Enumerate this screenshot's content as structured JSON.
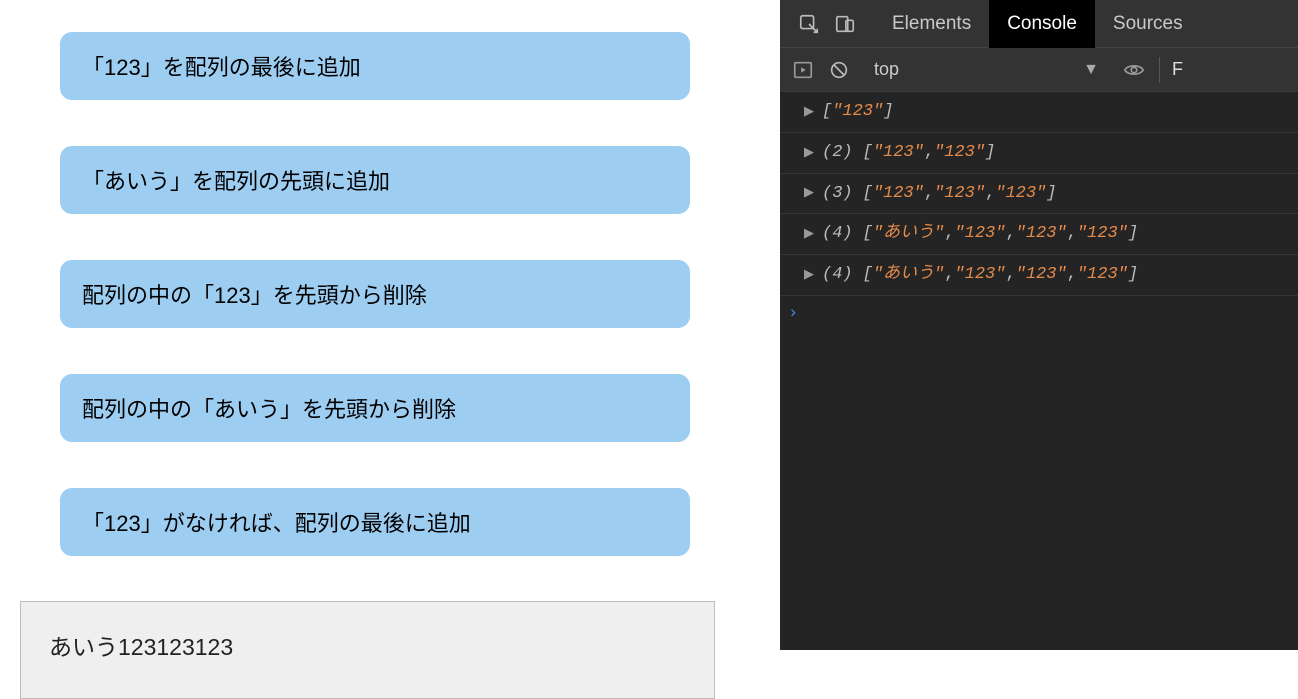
{
  "buttons": [
    "「123」を配列の最後に追加",
    "「あいう」を配列の先頭に追加",
    "配列の中の「123」を先頭から削除",
    "配列の中の「あいう」を先頭から削除",
    "「123」がなければ、配列の最後に追加"
  ],
  "output_text": "あいう123123123",
  "devtools": {
    "tabs": {
      "elements": "Elements",
      "console": "Console",
      "sources": "Sources"
    },
    "context": "top",
    "filter_initial": "F",
    "prompt_glyph": "›",
    "logs": [
      {
        "count": null,
        "items": [
          "\"123\""
        ]
      },
      {
        "count": "(2)",
        "items": [
          "\"123\"",
          "\"123\""
        ]
      },
      {
        "count": "(3)",
        "items": [
          "\"123\"",
          "\"123\"",
          "\"123\""
        ]
      },
      {
        "count": "(4)",
        "items": [
          "\"あいう\"",
          "\"123\"",
          "\"123\"",
          "\"123\""
        ]
      },
      {
        "count": "(4)",
        "items": [
          "\"あいう\"",
          "\"123\"",
          "\"123\"",
          "\"123\""
        ]
      }
    ]
  }
}
